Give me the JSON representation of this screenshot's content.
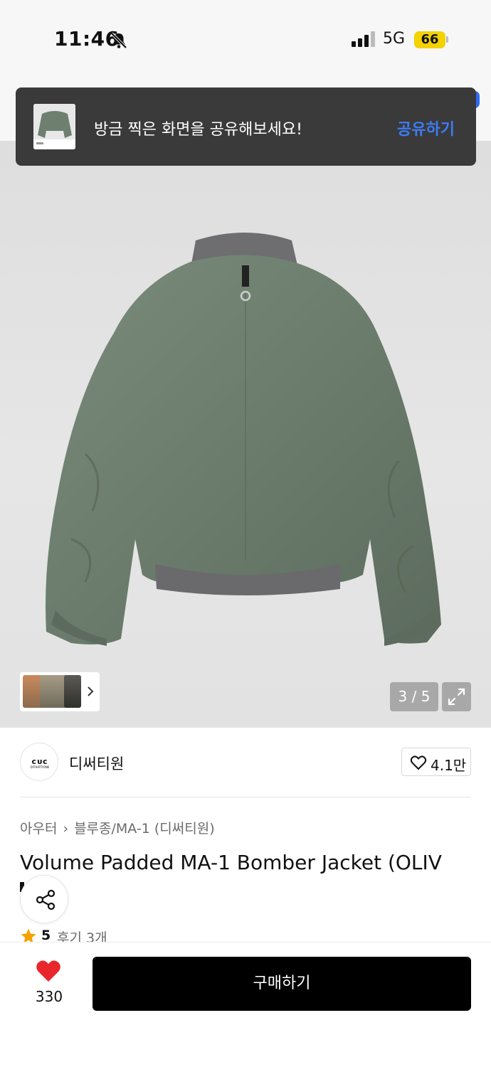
{
  "status_bar": {
    "time": "11:46",
    "network": "5G",
    "battery": "66",
    "icons": [
      "bell-slash-icon",
      "signal-icon",
      "battery-icon"
    ]
  },
  "toast": {
    "message": "방금 찍은 화면을 공유해보세요!",
    "action": "공유하기"
  },
  "gallery": {
    "counter": "3 / 5",
    "icons": [
      "expand-icon",
      "chevron-right-icon"
    ]
  },
  "brand": {
    "logo_text": "ᴄᴜᴄ",
    "logo_sub": "DITHIRTYONE",
    "name": "디써티원",
    "likes": "4.1만"
  },
  "breadcrumb": {
    "category": "아우터",
    "subcategory": "블루종/MA-1 (디써티원)"
  },
  "product": {
    "title": "Volume Padded MA-1 Bomber Jacket (OLIV",
    "rating": "5",
    "reviews": "후기 3개"
  },
  "bottom_bar": {
    "wish_count": "330",
    "buy_label": "구매하기"
  },
  "colors": {
    "accent_blue": "#3d7bf6",
    "heart_red": "#e8262b",
    "star_orange": "#f5a200",
    "jacket_green": "#6e7f70",
    "battery_yellow": "#f3d200"
  }
}
